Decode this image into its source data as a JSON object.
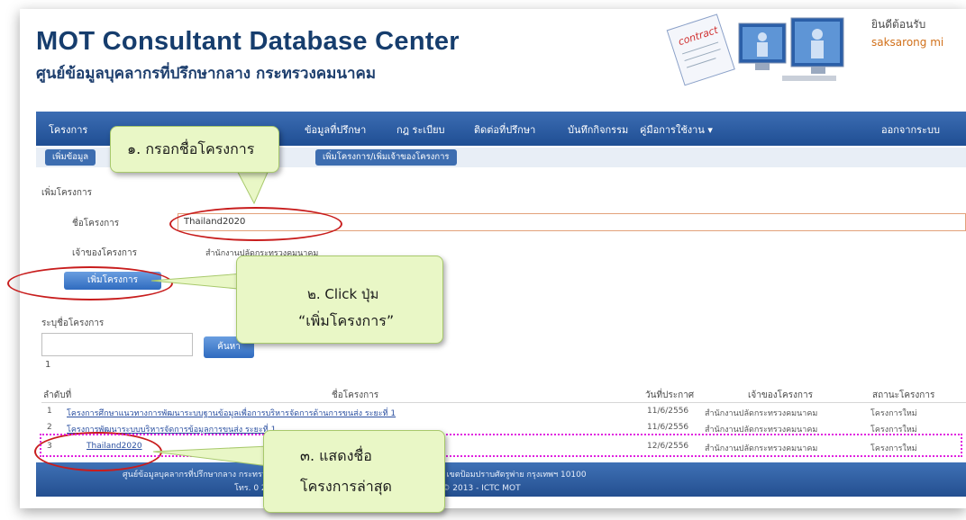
{
  "header": {
    "title": "MOT Consultant Database Center",
    "subtitle": "ศูนย์ข้อมูลบุคลากรที่ปรึกษากลาง กระทรวงคมนาคม",
    "welcome": "ยินดีต้อนรับ",
    "username": "saksarong mi",
    "logo_caption": "contract"
  },
  "nav": {
    "items": [
      "โครงการ",
      "ข้อมูลที่ปรึกษา",
      "กฎ ระเบียบ",
      "ติดต่อที่ปรึกษา",
      "บันทึกกิจกรรม",
      "คู่มือการใช้งาน ▾",
      "ออกจากระบบ"
    ],
    "sub_items": [
      "เพิ่มข้อมูล",
      "เพิ่มโครงการ/เพิ่มเจ้าของโครงการ"
    ]
  },
  "form": {
    "section_label": "เพิ่มโครงการ",
    "name_label": "ชื่อโครงการ",
    "name_value": "Thailand2020",
    "owner_label": "เจ้าของโครงการ",
    "owner_value": "สำนักงานปลัดกระทรวงคมนาคม",
    "add_button": "เพิ่มโครงการ"
  },
  "search": {
    "label": "ระบุชื่อโครงการ",
    "button": "ค้นหา",
    "page": "1"
  },
  "table": {
    "headers": [
      "ลำดับที่",
      "ชื่อโครงการ",
      "วันที่ประกาศ",
      "เจ้าของโครงการ",
      "สถานะโครงการ"
    ],
    "rows": [
      {
        "no": "1",
        "name": "โครงการศึกษาแนวทางการพัฒนาระบบฐานข้อมูลเพื่อการบริหารจัดการด้านการขนส่ง ระยะที่ 1",
        "date": "11/6/2556",
        "owner": "สำนักงานปลัดกระทรวงคมนาคม",
        "status": "โครงการใหม่"
      },
      {
        "no": "2",
        "name": "โครงการพัฒนาระบบบริหารจัดการข้อมูลการขนส่ง ระยะที่ 1",
        "date": "11/6/2556",
        "owner": "สำนักงานปลัดกระทรวงคมนาคม",
        "status": "โครงการใหม่"
      },
      {
        "no": "3",
        "name": "Thailand2020",
        "date": "12/6/2556",
        "owner": "สำนักงานปลัดกระทรวงคมนาคม",
        "status": "โครงการใหม่"
      }
    ]
  },
  "footer": {
    "line1": "ศูนย์ข้อมูลบุคลากรที่ปรึกษากลาง กระทรวงคมนาคม 38 ถนนราชดำเนินนอก แขวงวัดโสมนัส เขตป้อมปราบศัตรูพ่าย กรุงเทพฯ 10100",
    "line2": "โทร. 0 2283 3059   อีเมล์ : mot@mot.go.th   Copyright © 2013 - ICTC MOT"
  },
  "callouts": {
    "step1": "๑. กรอกชื่อโครงการ",
    "step2_line1": "๒. Click ปุ่ม",
    "step2_line2": "“เพิ่มโครงการ”",
    "step3_line1": "๓. แสดงชื่อ",
    "step3_line2": "โครงการล่าสุด"
  },
  "colors": {
    "navbar": "#2a5aa0",
    "title": "#163d6d",
    "callout": "#e9f7c6",
    "highlight_red": "#c81d1d",
    "highlight_magenta": "#e020e0"
  }
}
